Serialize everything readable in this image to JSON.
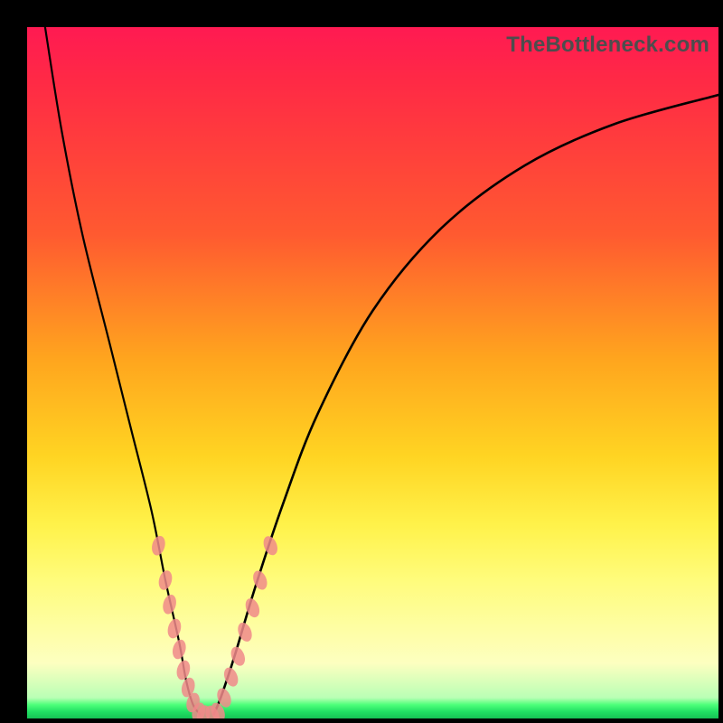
{
  "watermark": {
    "text": "TheBottleneck.com"
  },
  "colors": {
    "frame": "#000000",
    "gradient_top": "#ff1a52",
    "gradient_mid": "#ffd422",
    "gradient_bottom": "#16c255",
    "curve": "#000000",
    "bead": "#f08a8a"
  },
  "chart_data": {
    "type": "line",
    "title": "",
    "xlabel": "",
    "ylabel": "",
    "xlim": [
      0,
      100
    ],
    "ylim": [
      0,
      100
    ],
    "grid": false,
    "legend": false,
    "note": "V-shaped bottleneck curve on rainbow gradient. Axes are unlabeled; data values are estimated from approximate geometry. Beads mark notable points near the valley on both limbs.",
    "series": [
      {
        "name": "left_limb",
        "x": [
          2.6,
          5,
          8,
          12,
          15,
          18,
          20,
          22,
          23,
          24,
          25
        ],
        "values": [
          100,
          85,
          70,
          54,
          42,
          30,
          20,
          11,
          5.5,
          2,
          0.6
        ]
      },
      {
        "name": "right_limb",
        "x": [
          27,
          28,
          30,
          33,
          37,
          42,
          50,
          60,
          72,
          85,
          100
        ],
        "values": [
          0.6,
          3,
          9,
          19,
          31,
          44,
          59,
          71,
          80,
          86,
          90.2
        ]
      }
    ],
    "beads": {
      "left": [
        {
          "x": 19,
          "y": 25
        },
        {
          "x": 20,
          "y": 20
        },
        {
          "x": 20.6,
          "y": 16.5
        },
        {
          "x": 21.3,
          "y": 13
        },
        {
          "x": 22,
          "y": 10
        },
        {
          "x": 22.6,
          "y": 7
        },
        {
          "x": 23.3,
          "y": 4.5
        },
        {
          "x": 24,
          "y": 2.3
        },
        {
          "x": 24.8,
          "y": 0.9
        },
        {
          "x": 25.5,
          "y": 0.5
        }
      ],
      "right": [
        {
          "x": 26.8,
          "y": 0.5
        },
        {
          "x": 27.6,
          "y": 0.9
        },
        {
          "x": 28.5,
          "y": 3
        },
        {
          "x": 29.5,
          "y": 6
        },
        {
          "x": 30.5,
          "y": 9
        },
        {
          "x": 31.5,
          "y": 12.5
        },
        {
          "x": 32.6,
          "y": 16
        },
        {
          "x": 33.7,
          "y": 20
        },
        {
          "x": 35.2,
          "y": 25
        }
      ]
    }
  }
}
